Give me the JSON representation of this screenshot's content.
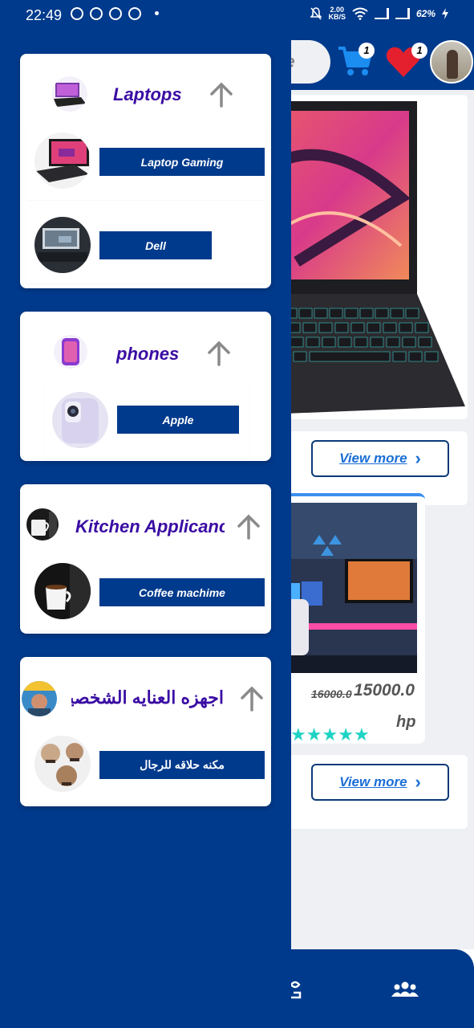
{
  "status_bar": {
    "time": "22:49",
    "speed_value": "2.00",
    "speed_unit": "KB/S",
    "battery": "62%"
  },
  "header": {
    "search_placeholder": "me",
    "cart_count": "1",
    "wishlist_count": "1"
  },
  "products": {
    "view_more_1": "View more",
    "view_more_2": "View more",
    "old_price": "16000.0",
    "new_price": "15000.0",
    "brand": "hp",
    "rating_stars": 5
  },
  "drawer": {
    "categories": [
      {
        "title": "Laptops",
        "subcategories": [
          {
            "label": "Laptop Gaming"
          },
          {
            "label": "Dell"
          }
        ]
      },
      {
        "title": "phones",
        "subcategories": [
          {
            "label": "Apple"
          }
        ]
      },
      {
        "title": "Kitchen Applicanc",
        "subcategories": [
          {
            "label": "Coffee machime"
          }
        ]
      },
      {
        "title": "اجهزه العنايه الشخصيه",
        "subcategories": [
          {
            "label": "مكنه حلاقه للرجال"
          }
        ]
      }
    ]
  },
  "colors": {
    "primary": "#003a8c",
    "title_purple": "#3a0ca3",
    "link_blue": "#1b6fd6",
    "star_teal": "#1fd3c4",
    "heart_red": "#e5202e"
  }
}
